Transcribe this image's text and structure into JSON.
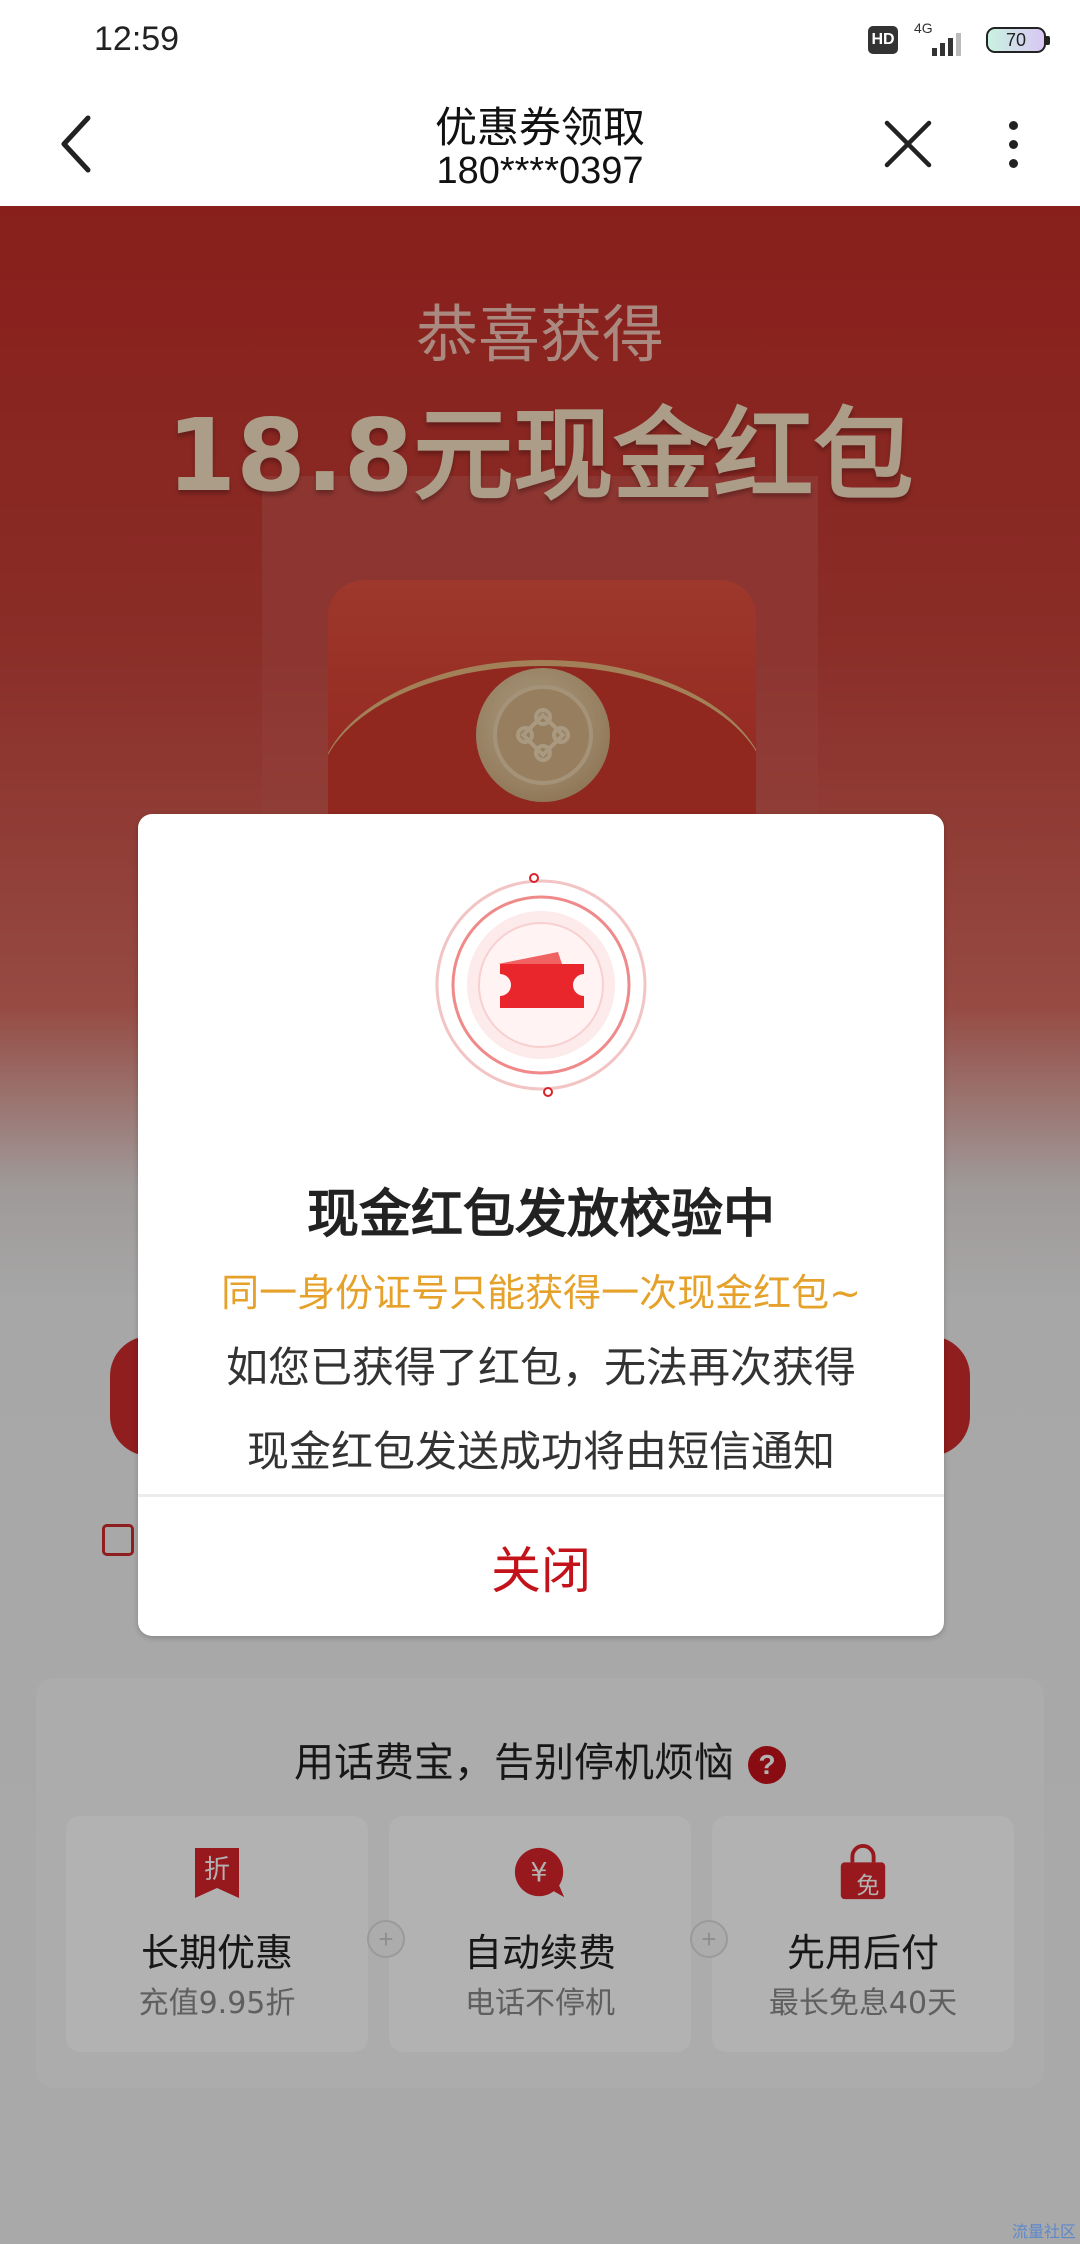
{
  "status_bar": {
    "time": "12:59",
    "hd_label": "HD",
    "network_label": "4G",
    "battery_level": "70"
  },
  "nav": {
    "title": "优惠券领取",
    "subtitle": "180****0397"
  },
  "page": {
    "congrats_text": "恭喜获得",
    "amount_title": "18.8元现金红包",
    "feature_heading": "用话费宝，告别停机烦恼",
    "help_glyph": "?",
    "features": [
      {
        "title": "长期优惠",
        "sub": "充值9.95折",
        "icon": "discount-tag-icon",
        "glyph": "折"
      },
      {
        "title": "自动续费",
        "sub": "电话不停机",
        "icon": "yuan-coin-icon",
        "glyph": "¥"
      },
      {
        "title": "先用后付",
        "sub": "最长免息40天",
        "icon": "shopping-bag-icon",
        "glyph": "免"
      }
    ]
  },
  "modal": {
    "title": "现金红包发放校验中",
    "warning": "同一身份证号只能获得一次现金红包~",
    "line1": "如您已获得了红包，无法再次获得",
    "line2": "现金红包发送成功将由短信通知",
    "close_label": "关闭"
  },
  "watermark": "流量社区",
  "colors": {
    "brand_red": "#c4121a",
    "warning_orange": "#e5a12a",
    "page_red": "#c32d27"
  }
}
